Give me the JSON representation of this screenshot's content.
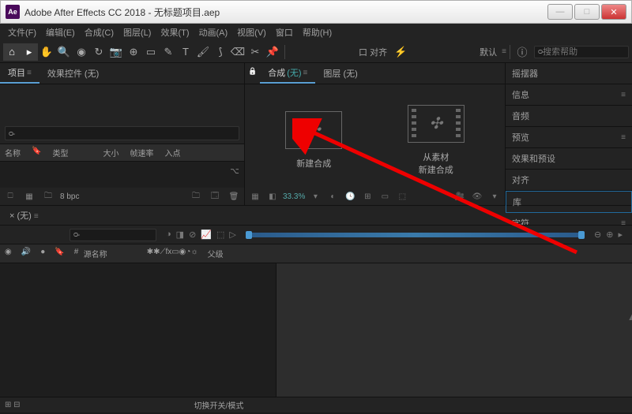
{
  "titlebar": {
    "app_icon_text": "Ae",
    "title": "Adobe After Effects CC 2018 - 无标题项目.aep"
  },
  "menu": {
    "items": [
      "文件(F)",
      "编辑(E)",
      "合成(C)",
      "图层(L)",
      "效果(T)",
      "动画(A)",
      "视图(V)",
      "窗口",
      "帮助(H)"
    ]
  },
  "toolbar": {
    "snap_label": "口 对齐",
    "default_label": "默认",
    "search_placeholder": "搜索帮助"
  },
  "project": {
    "tab_project": "项目",
    "tab_controls": "效果控件 (无)",
    "search_placeholder": "",
    "cols": [
      "名称",
      "类型",
      "大小",
      "帧速率",
      "入点"
    ],
    "bpc": "8 bpc"
  },
  "comp": {
    "tab_comp_prefix": "合成",
    "tab_comp_state": "(无)",
    "tab_layer": "图层 (无)",
    "new_comp": "新建合成",
    "from_footage_line1": "从素材",
    "from_footage_line2": "新建合成",
    "zoom": "33.3%"
  },
  "right_panels": {
    "items": [
      "摇摆器",
      "信息",
      "音频",
      "预览",
      "效果和预设",
      "对齐",
      "库",
      "字符"
    ],
    "selected_index": 6,
    "font": "微软雅黑"
  },
  "timeline": {
    "tab": "(无)",
    "time": "",
    "source_name": "源名称",
    "parent": "父级",
    "switches_label": "切换开关/模式"
  }
}
